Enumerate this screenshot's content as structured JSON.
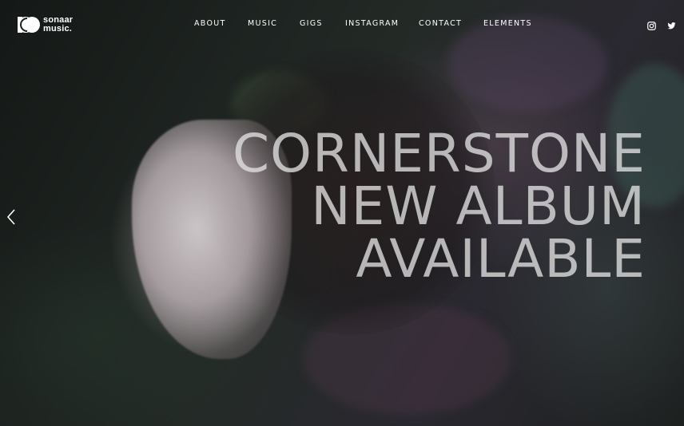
{
  "brand": {
    "line1": "sonaar",
    "line2": "music."
  },
  "nav": {
    "items": [
      {
        "label": "ABOUT"
      },
      {
        "label": "MUSIC"
      },
      {
        "label": "GIGS"
      },
      {
        "label": "INSTAGRAM"
      },
      {
        "label": "CONTACT"
      },
      {
        "label": "ELEMENTS"
      }
    ]
  },
  "social": {
    "icons": [
      "instagram-icon",
      "twitter-icon"
    ]
  },
  "slider": {
    "prev_icon": "chevron-left-icon"
  },
  "hero": {
    "lines": [
      "CORNERSTONE",
      "NEW ALBUM",
      "AVAILABLE"
    ]
  },
  "colors": {
    "text": "#ffffff",
    "headline": "#e1e1e1",
    "background": "#1b1f1c"
  }
}
